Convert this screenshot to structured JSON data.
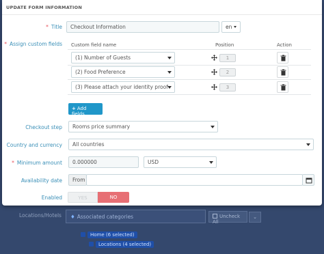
{
  "modal": {
    "title": "UPDATE FORM INFORMATION",
    "title_field": {
      "label": "Title",
      "value": "Checkout Information",
      "lang": "en"
    },
    "custom_fields": {
      "label": "Assign custom fields",
      "columns": {
        "name": "Custom field name",
        "position": "Position",
        "action": "Action"
      },
      "rows": [
        {
          "name": "(1) Number of Guests",
          "position": "1"
        },
        {
          "name": "(2) Food Preference",
          "position": "2"
        },
        {
          "name": "(3) Please attach your identity proof",
          "position": "3"
        }
      ],
      "add_button": "Add fields"
    },
    "checkout_step": {
      "label": "Checkout step",
      "value": "Rooms price summary"
    },
    "currency": {
      "label": "Country and currency",
      "value": "All countries"
    },
    "minimum_amount": {
      "label": "Minimum amount",
      "value": "0.000000",
      "currency": "USD"
    },
    "availability": {
      "label": "Availability date",
      "from": "From"
    },
    "enabled": {
      "label": "Enabled",
      "yes": "YES",
      "no": "NO"
    }
  },
  "background": {
    "locations_label": "Locations/Hotels",
    "associated_categories": "Associated categories",
    "uncheck_all": "Uncheck All",
    "tree": [
      "Home (6 selected)",
      "Locations (4 selected)"
    ]
  },
  "colors": {
    "label": "#3a8fb7",
    "required": "#e8505b",
    "primary_button": "#2097c9",
    "toggle_no": "#e76f74",
    "backdrop": "#34486d"
  }
}
